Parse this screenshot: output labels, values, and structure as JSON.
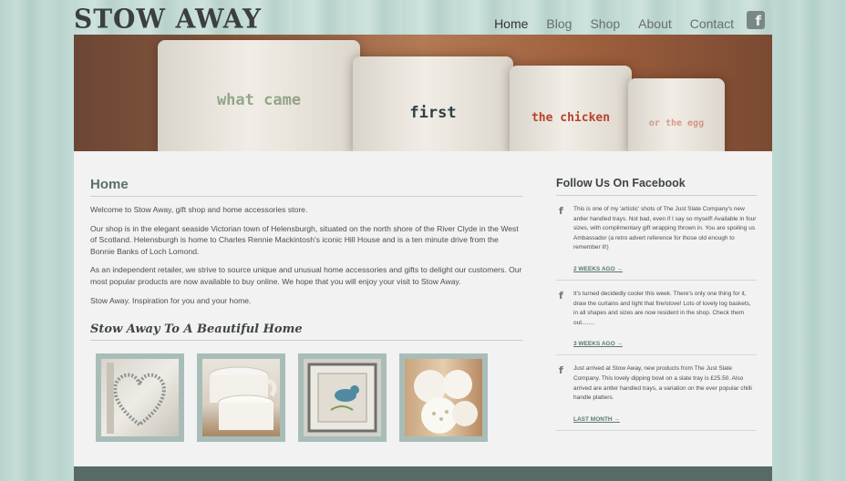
{
  "header": {
    "logo": "STOW AWAY",
    "nav": [
      "Home",
      "Blog",
      "Shop",
      "About",
      "Contact"
    ],
    "active_nav": "Home",
    "facebook_icon": "f"
  },
  "hero": {
    "mug_words": [
      "what came",
      "first",
      "the chicken",
      "or the egg"
    ]
  },
  "main": {
    "title": "Home",
    "paragraphs": [
      "Welcome to Stow Away, gift shop and home accessories store.",
      "Our shop is in the elegant seaside Victorian town of Helensburgh, situated on the north shore of the River Clyde in the West of Scotland. Helensburgh is home to Charles Rennie Mackintosh's iconic Hill House and is a ten minute drive from the Bonnie Banks of Loch Lomond.",
      "As an independent retailer, we strive to source unique and unusual home accessories and gifts to delight our customers. Our most popular products are now available to buy online. We hope that you will enjoy your visit to Stow Away.",
      "Stow Away. Inspiration for you and your home."
    ],
    "gallery_title": "Stow Away To A Beautiful Home"
  },
  "sidebar": {
    "title": "Follow Us On Facebook",
    "posts": [
      {
        "icon": "f",
        "text": "This is one of my 'artistic' shots of The Just Slate Company's new antler handled trays. Not bad, even if I say so myself! Available in four sizes, with complimentary gift wrapping thrown in. You are spoiling us Ambassador (a retro advert reference for those old enough to remember it!)",
        "link": "2 WEEKS AGO →"
      },
      {
        "icon": "f",
        "text": "It's turned decidedly cooler this week. There's only one thing for it, draw the curtains and light that fire/stove! Lots of lovely log baskets, in all shapes and sizes are now resident in the shop. Check them out........",
        "link": "3 WEEKS AGO →"
      },
      {
        "icon": "f",
        "text": "Just arrived at Stow Away, new products from The Just Slate Company. This lovely dipping bowl on a slate tray is £25.50. Also arrived are antler handled trays, a variation on the ever popular chilli handle platters.",
        "link": "LAST MONTH →"
      }
    ]
  },
  "colors": {
    "accent": "#5c6e6a",
    "footer": "#586a66",
    "background": "#b9d4cf"
  }
}
